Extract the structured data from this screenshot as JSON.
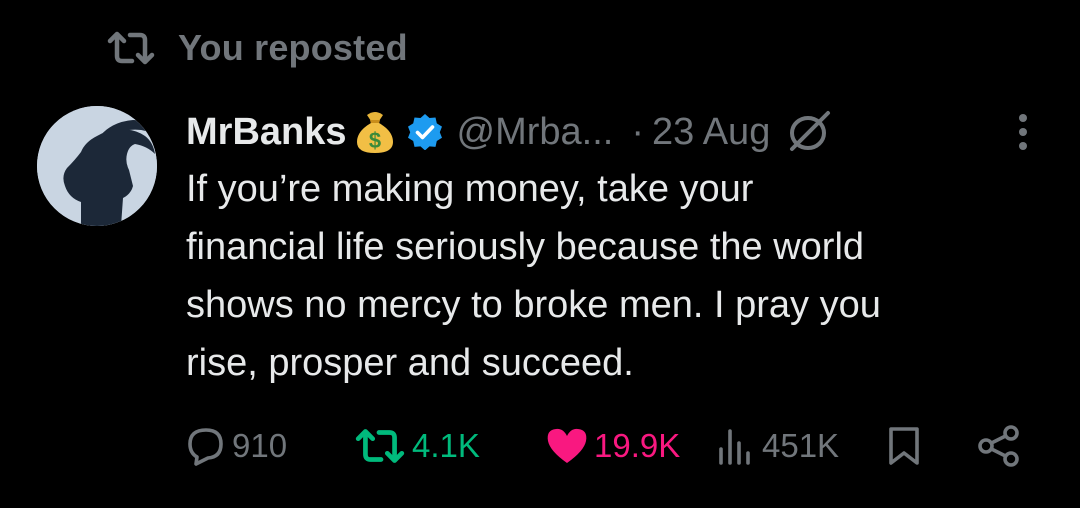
{
  "repost_header": {
    "text": "You reposted",
    "icon": "repost-icon"
  },
  "author": {
    "avatar_icon": "goat-silhouette-avatar",
    "display_name": "MrBanks",
    "name_emoji": "money-bag-icon",
    "verified_icon": "verified-badge-icon",
    "handle": "@Mrba...",
    "separator": "·",
    "time": "23 Aug",
    "edit_icon": "edited-icon",
    "more_icon": "more-options-icon"
  },
  "tweet": {
    "text": "If you’re making money, take your\nfinancial life seriously because the world\nshows no mercy to broke men. I pray you\nrise, prosper and succeed."
  },
  "actions": {
    "reply_count": "910",
    "repost_count": "4.1K",
    "like_count": "19.9K",
    "view_count": "451K",
    "bookmark_icon": "bookmark-icon",
    "share_icon": "share-icon"
  },
  "colors": {
    "background": "#000000",
    "text": "#e7e9ea",
    "muted": "#71767b",
    "repost_green": "#00ba7c",
    "like_pink": "#f91880",
    "verified_blue": "#1d9bf0"
  }
}
